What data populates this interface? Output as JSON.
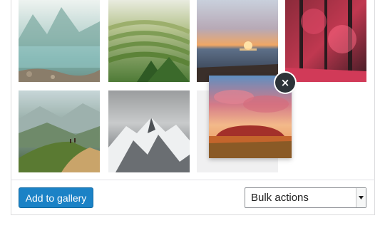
{
  "gallery": {
    "images": [
      {
        "name": "misty-lake"
      },
      {
        "name": "rice-terraces"
      },
      {
        "name": "ocean-sunset"
      },
      {
        "name": "red-forest"
      },
      {
        "name": "mountain-hikers"
      },
      {
        "name": "snowy-peaks"
      }
    ],
    "dragging_image": {
      "name": "uluru-sunset"
    },
    "remove_label": "×"
  },
  "footer": {
    "add_button_label": "Add to gallery",
    "bulk_select_value": "Bulk actions"
  }
}
